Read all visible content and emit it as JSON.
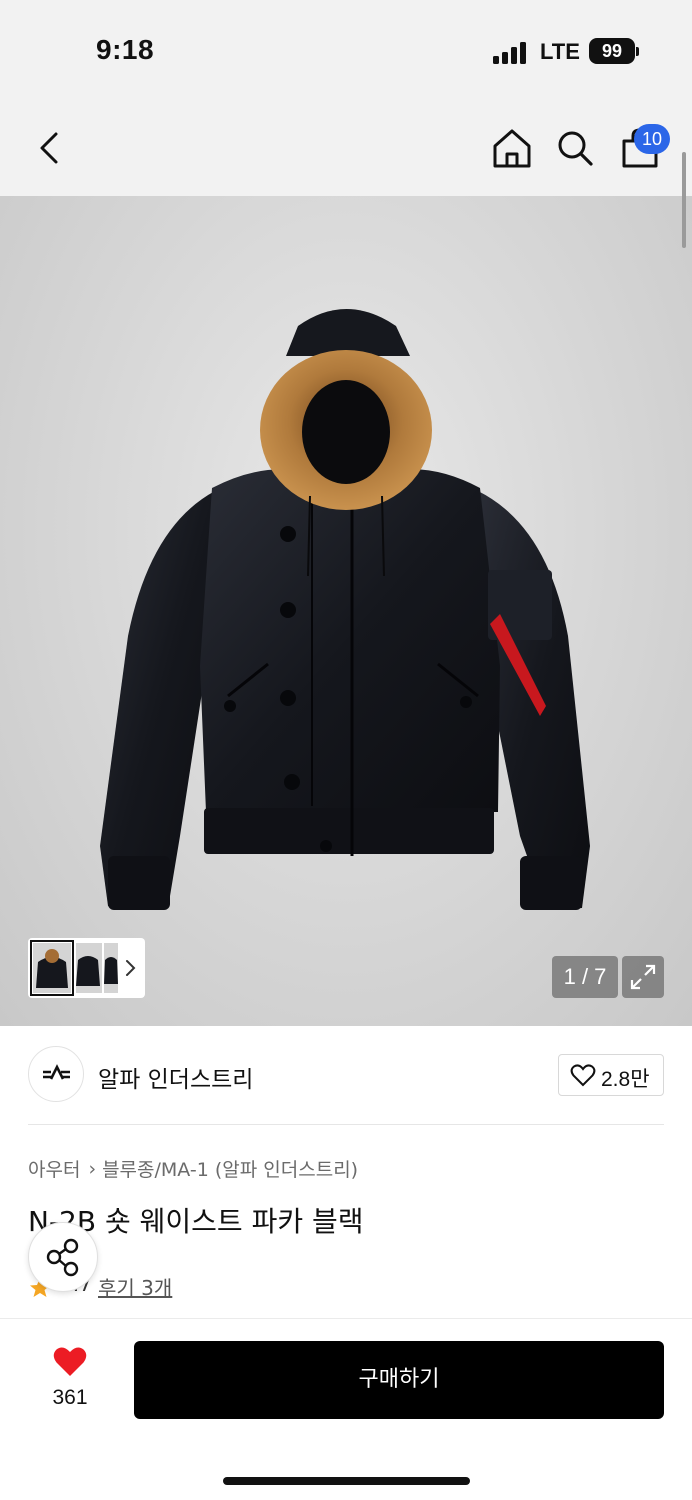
{
  "status_bar": {
    "time": "9:18",
    "network": "LTE",
    "battery": "99"
  },
  "header": {
    "back_icon": "chevron-left-icon",
    "home_icon": "home-icon",
    "search_icon": "search-icon",
    "cart_icon": "shopping-bag-icon",
    "cart_count": "10",
    "badge_color": "#2b66e8"
  },
  "gallery": {
    "counter": "1 / 7",
    "expand_icon": "expand-icon",
    "thumb_next_icon": "chevron-right-icon"
  },
  "brand": {
    "name": "알파 인더스트리",
    "logo_icon": "alpha-industries-logo",
    "like_count": "2.8만",
    "like_icon": "heart-outline-icon"
  },
  "product": {
    "breadcrumb": [
      "아우터",
      "블루종/MA-1 (알파 인더스트리)"
    ],
    "title": "N-2B 숏 웨이스트 파카 블랙",
    "rating": "4.7",
    "review_link": "후기 3개",
    "share_icon": "share-icon",
    "star_color": "#f5a623"
  },
  "bottom_bar": {
    "like_count": "361",
    "like_icon": "heart-filled-icon",
    "heart_color": "#ec1c24",
    "buy_label": "구매하기"
  }
}
